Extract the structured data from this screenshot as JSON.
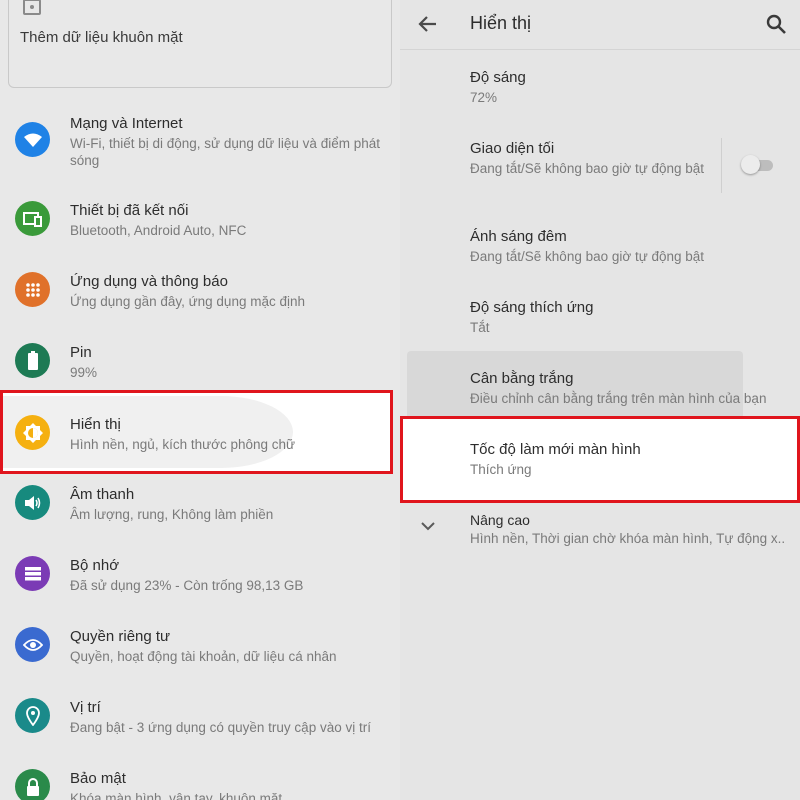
{
  "left_panel": {
    "face_card_label": "Thêm dữ liệu khuôn mặt",
    "items": [
      {
        "title": "Mạng và Internet",
        "sub": "Wi-Fi, thiết bị di động, sử dụng dữ liệu và điểm phát sóng",
        "icon": "wifi-icon",
        "color": "#1f82e6"
      },
      {
        "title": "Thiết bị đã kết nối",
        "sub": "Bluetooth, Android Auto, NFC",
        "icon": "devices-icon",
        "color": "#3a9a3a"
      },
      {
        "title": "Ứng dụng và thông báo",
        "sub": "Ứng dụng gần đây, ứng dụng mặc định",
        "icon": "apps-icon",
        "color": "#e0712a"
      },
      {
        "title": "Pin",
        "sub": "99%",
        "icon": "battery-icon",
        "color": "#1d7a54"
      },
      {
        "title": "Hiển thị",
        "sub": "Hình nền, ngủ, kích thước phông chữ",
        "icon": "brightness-icon",
        "color": "#f5b010"
      },
      {
        "title": "Âm thanh",
        "sub": "Âm lượng, rung, Không làm phiền",
        "icon": "volume-icon",
        "color": "#178a7e"
      },
      {
        "title": "Bộ nhớ",
        "sub": "Đã sử dụng 23% - Còn trống 98,13 GB",
        "icon": "storage-icon",
        "color": "#7b3bb5"
      },
      {
        "title": "Quyền riêng tư",
        "sub": "Quyền, hoạt động tài khoản, dữ liệu cá nhân",
        "icon": "privacy-eye-icon",
        "color": "#3a6ad0"
      },
      {
        "title": "Vị trí",
        "sub": "Đang bật - 3 ứng dụng có quyền truy cập vào vị trí",
        "icon": "location-icon",
        "color": "#1a8a8a"
      },
      {
        "title": "Bảo mật",
        "sub": "Khóa màn hình, vân tay, khuôn mặt",
        "icon": "lock-icon",
        "color": "#2a8a4a"
      }
    ]
  },
  "right_panel": {
    "title": "Hiển thị",
    "items": [
      {
        "title": "Độ sáng",
        "sub": "72%"
      },
      {
        "title": "Giao diện tối",
        "sub": "Đang tắt/Sẽ không bao giờ tự động bật",
        "toggle_on": false
      },
      {
        "title": "Ánh sáng đêm",
        "sub": "Đang tắt/Sẽ không bao giờ tự động bật"
      },
      {
        "title": "Độ sáng thích ứng",
        "sub": "Tắt"
      },
      {
        "title": "Cân bằng trắng",
        "sub": "Điều chỉnh cân bằng trắng trên màn hình của bạn"
      },
      {
        "title": "Tốc độ làm mới màn hình",
        "sub": "Thích ứng"
      },
      {
        "title": "Nâng cao",
        "sub": "Hình nền, Thời gian chờ khóa màn hình, Tự động x.."
      }
    ]
  },
  "colors": {
    "highlight_border": "#e0151d"
  }
}
